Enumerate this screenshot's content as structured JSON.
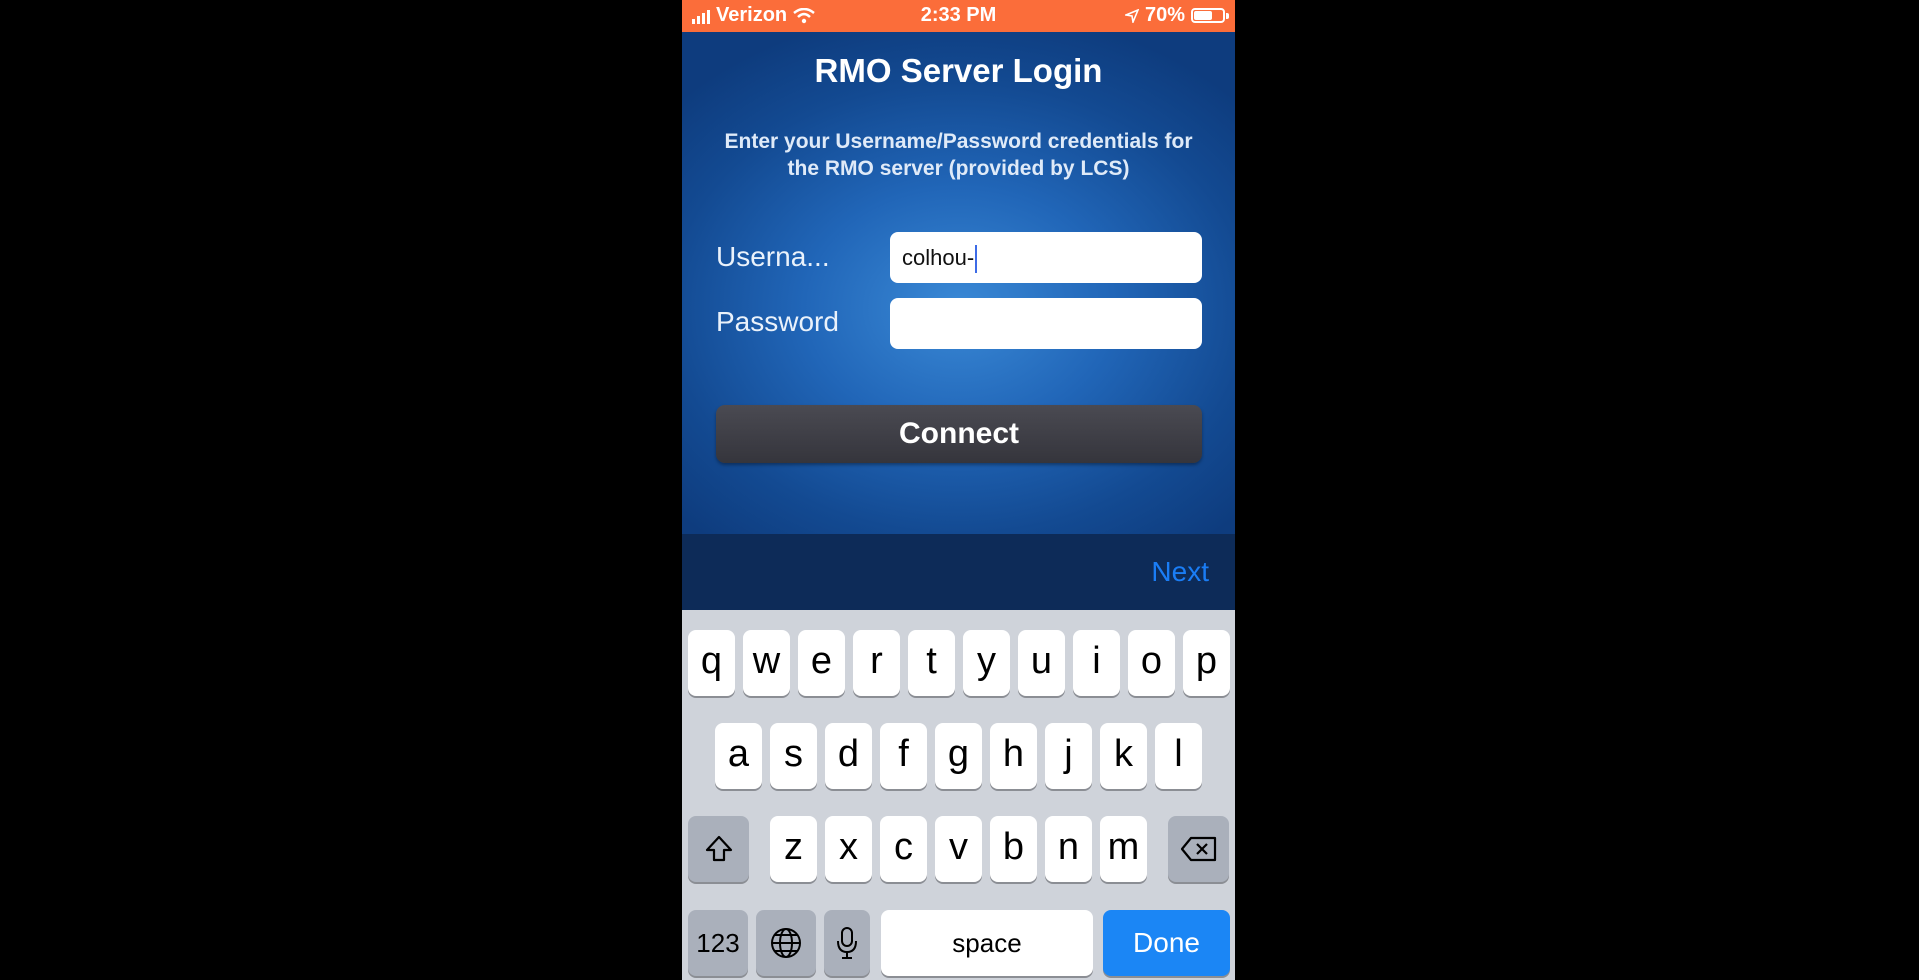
{
  "status_bar": {
    "carrier": "Verizon",
    "time": "2:33 PM",
    "battery_percent": "70%",
    "battery_level": 0.7
  },
  "login": {
    "title": "RMO Server Login",
    "subtitle": "Enter your Username/Password credentials for the RMO server (provided by LCS)",
    "username_label": "Userna...",
    "username_value": "colhou-",
    "password_label": "Password",
    "password_value": "",
    "connect_label": "Connect"
  },
  "accessory": {
    "next_label": "Next"
  },
  "keyboard": {
    "row1": [
      "q",
      "w",
      "e",
      "r",
      "t",
      "y",
      "u",
      "i",
      "o",
      "p"
    ],
    "row2": [
      "a",
      "s",
      "d",
      "f",
      "g",
      "h",
      "j",
      "k",
      "l"
    ],
    "row3": [
      "z",
      "x",
      "c",
      "v",
      "b",
      "n",
      "m"
    ],
    "numbers_label": "123",
    "space_label": "space",
    "done_label": "Done"
  },
  "colors": {
    "status_bar": "#fb6d3a",
    "accent": "#1b86f5",
    "login_bg": "#2166b8",
    "connect_button": "#3d3d44"
  }
}
